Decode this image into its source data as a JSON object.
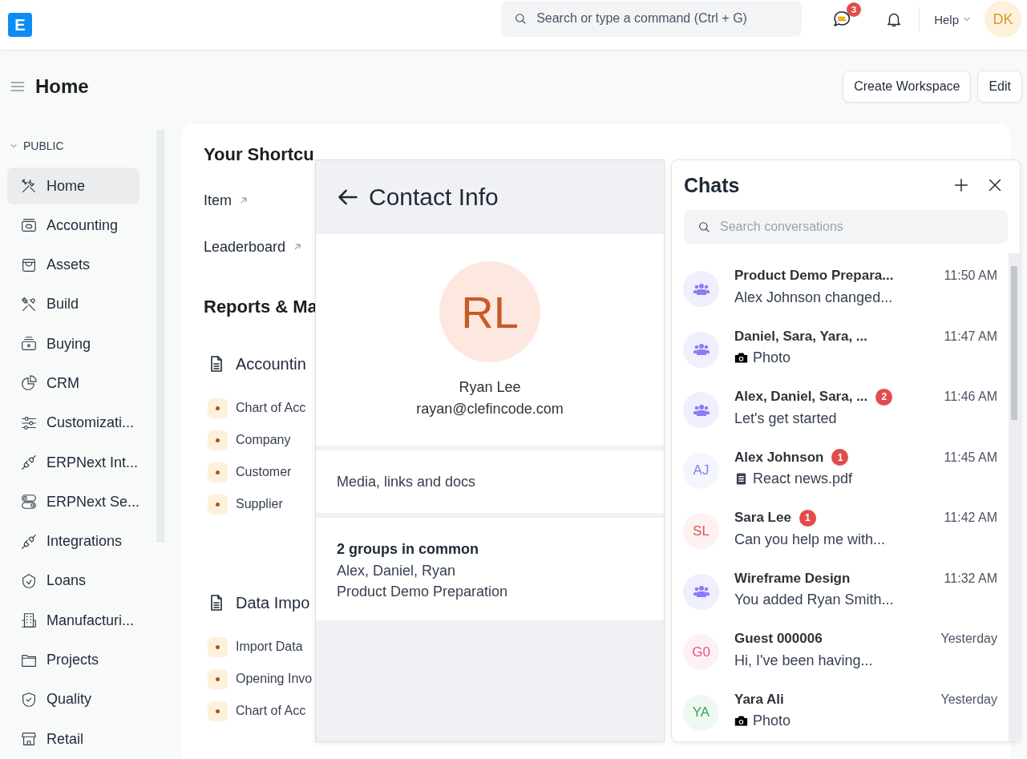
{
  "navbar": {
    "logo": "E",
    "search": {
      "placeholder": "Search or type a command (Ctrl + G)"
    },
    "chat_badge": "3",
    "help": "Help",
    "avatar": "DK"
  },
  "page": {
    "title": "Home",
    "buttons": [
      "Create Workspace",
      "Edit"
    ]
  },
  "sidebar": {
    "section": "PUBLIC",
    "expanded": true,
    "items": [
      {
        "label": "Home",
        "selected": true
      },
      {
        "label": "Accounting",
        "selected": false
      },
      {
        "label": "Assets",
        "selected": false
      },
      {
        "label": "Build",
        "selected": false
      },
      {
        "label": "Buying",
        "selected": false
      },
      {
        "label": "CRM",
        "selected": false
      },
      {
        "label": "Customizati...",
        "selected": false
      },
      {
        "label": "ERPNext Int...",
        "selected": false
      },
      {
        "label": "ERPNext Se...",
        "selected": false
      },
      {
        "label": "Integrations",
        "selected": false
      },
      {
        "label": "Loans",
        "selected": false
      },
      {
        "label": "Manufacturi...",
        "selected": false
      },
      {
        "label": "Projects",
        "selected": false
      },
      {
        "label": "Quality",
        "selected": false
      },
      {
        "label": "Retail",
        "selected": false
      }
    ]
  },
  "workspace": {
    "shortcuts_title": "Your Shortcu",
    "shortcuts": [
      "Item",
      "Leaderboard"
    ],
    "reports_title": "Reports & Ma",
    "cards": [
      {
        "title": "Accountin",
        "links": [
          "Chart of Acc",
          "Company",
          "Customer",
          "Supplier"
        ]
      },
      {
        "title": "Data Impo",
        "links": [
          "Import Data",
          "Opening Invo",
          "Chart of Acc"
        ]
      }
    ]
  },
  "contact_info": {
    "title": "Contact Info",
    "avatar": "RL",
    "name": "Ryan Lee",
    "email": "rayan@clefincode.com",
    "media": "Media, links and docs",
    "groups_title": "2 groups in common",
    "groups": [
      "Alex, Daniel, Ryan",
      "Product Demo Preparation"
    ]
  },
  "chats": {
    "title": "Chats",
    "search": {
      "placeholder": "Search conversations"
    },
    "items": [
      {
        "name": "Product Demo Prepara...",
        "time": "11:50 AM",
        "preview": "Alex Johnson changed...",
        "avatar": {
          "kind": "group",
          "color": "#8b7cf6"
        }
      },
      {
        "name": "Daniel, Sara, Yara, ...",
        "time": "11:47 AM",
        "preview": "Photo",
        "avatar": {
          "kind": "group",
          "color": "#8b7cf6"
        },
        "attachment": {
          "kind": "photo"
        }
      },
      {
        "name": "Alex, Daniel, Sara, ...",
        "badge": "2",
        "time": "11:46 AM",
        "preview": "Let's get started",
        "avatar": {
          "kind": "group",
          "color": "#8b7cf6"
        }
      },
      {
        "name": "Alex Johnson",
        "badge": "1",
        "time": "11:45 AM",
        "preview": "React news.pdf",
        "avatar": {
          "kind": "initials",
          "initials": "AJ",
          "color": "#7c83e8"
        },
        "attachment": {
          "kind": "file"
        }
      },
      {
        "name": "Sara Lee",
        "badge": "1",
        "time": "11:42 AM",
        "preview": "Can you help me with...",
        "avatar": {
          "kind": "initials",
          "initials": "SL",
          "color": "#e0505a"
        }
      },
      {
        "name": "Wireframe Design",
        "time": "11:32 AM",
        "preview": "You added Ryan Smith...",
        "avatar": {
          "kind": "group",
          "color": "#8b7cf6"
        }
      },
      {
        "name": "Guest 000006",
        "time": "Yesterday",
        "preview": "Hi, I've been having...",
        "avatar": {
          "kind": "initials",
          "initials": "G0",
          "color": "#e8508a"
        }
      },
      {
        "name": "Yara Ali",
        "time": "Yesterday",
        "preview": "Photo",
        "avatar": {
          "kind": "initials",
          "initials": "YA",
          "color": "#3aa35a"
        },
        "attachment": {
          "kind": "photo"
        }
      }
    ]
  }
}
